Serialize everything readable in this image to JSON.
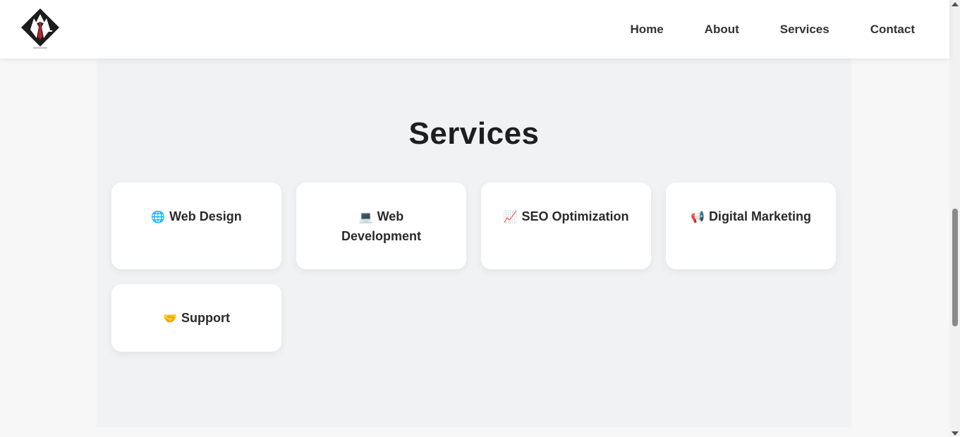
{
  "nav": {
    "logo_icon": "tuxedo-diamond-logo",
    "links": [
      {
        "label": "Home"
      },
      {
        "label": "About"
      },
      {
        "label": "Services"
      },
      {
        "label": "Contact"
      }
    ]
  },
  "services": {
    "title": "Services",
    "cards": [
      {
        "emoji": "🌐",
        "label": "Web Design"
      },
      {
        "emoji": "💻",
        "label": "Web Development"
      },
      {
        "emoji": "📈",
        "label": "SEO Optimization"
      },
      {
        "emoji": "📢",
        "label": "Digital Marketing"
      },
      {
        "emoji": "🤝",
        "label": "Support"
      }
    ]
  },
  "colors": {
    "nav_bg": "#ffffff",
    "section_bg": "#f1f2f4",
    "card_bg": "#ffffff",
    "accent_tie": "#c0202b"
  }
}
